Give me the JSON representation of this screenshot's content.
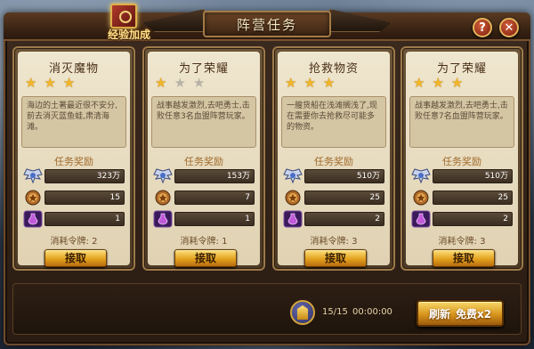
{
  "header": {
    "title": "阵营任务",
    "exp_bonus_label": "经验加成",
    "help_label": "?",
    "close_label": "✕"
  },
  "labels": {
    "reward_title": "任务奖励",
    "claim": "接取"
  },
  "cards": [
    {
      "title": "消灭魔物",
      "stars_filled": 3,
      "stars_total": 3,
      "description": "海边的土著最近很不安分,前去消灭蓝鱼蛙,肃清海滩。",
      "rewards": {
        "exp": "323万",
        "honor": "15",
        "potion": "1"
      },
      "cost": "消耗令牌: 2"
    },
    {
      "title": "为了荣耀",
      "stars_filled": 1,
      "stars_total": 3,
      "description": "战事越发激烈,去吧勇士,击败任意3名血盟阵营玩家。",
      "rewards": {
        "exp": "153万",
        "honor": "7",
        "potion": "1"
      },
      "cost": "消耗令牌: 1"
    },
    {
      "title": "抢救物资",
      "stars_filled": 3,
      "stars_total": 3,
      "description": "一艘货船在浅滩搁浅了,现在需要你去抢救尽可能多的物资。",
      "rewards": {
        "exp": "510万",
        "honor": "25",
        "potion": "2"
      },
      "cost": "消耗令牌: 3"
    },
    {
      "title": "为了荣耀",
      "stars_filled": 3,
      "stars_total": 3,
      "description": "战事越发激烈,去吧勇士,击败任意7名血盟阵营玩家。",
      "rewards": {
        "exp": "510万",
        "honor": "25",
        "potion": "2"
      },
      "cost": "消耗令牌: 3"
    }
  ],
  "footer": {
    "token_count": "15/15",
    "timer": "00:00:00",
    "refresh_label": "刷新",
    "free_label": "免费x2"
  },
  "icons": {
    "exp": "exp-wings-icon",
    "honor": "honor-medal-icon",
    "potion": "potion-icon",
    "token": "token-shield-icon",
    "star": "star-icon"
  },
  "colors": {
    "star_on": "#f1b62c",
    "star_off": "#b7b2a6",
    "button_gold": "#e3a11f",
    "title_text": "#f6e6bf"
  }
}
